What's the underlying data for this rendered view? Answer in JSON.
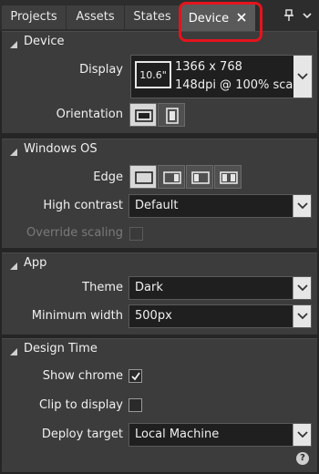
{
  "tabs": [
    {
      "label": "Projects"
    },
    {
      "label": "Assets"
    },
    {
      "label": "States"
    },
    {
      "label": "Device"
    }
  ],
  "sections": {
    "device": {
      "title": "Device",
      "display_label": "Display",
      "display_size": "10.6\"",
      "display_resolution": "1366 x 768",
      "display_dpi": "148dpi @ 100% scale",
      "orientation_label": "Orientation"
    },
    "windows": {
      "title": "Windows OS",
      "edge_label": "Edge",
      "high_contrast_label": "High contrast",
      "high_contrast_value": "Default",
      "override_scaling_label": "Override scaling"
    },
    "app": {
      "title": "App",
      "theme_label": "Theme",
      "theme_value": "Dark",
      "min_width_label": "Minimum width",
      "min_width_value": "500px"
    },
    "design": {
      "title": "Design Time",
      "show_chrome_label": "Show chrome",
      "show_chrome_checked": true,
      "clip_label": "Clip to display",
      "clip_checked": false,
      "deploy_label": "Deploy target",
      "deploy_value": "Local Machine"
    }
  },
  "icons": {
    "pin": "pin-icon",
    "help": "help-icon"
  },
  "colors": {
    "highlight": "#e3141d",
    "background": "#3c3c3c"
  }
}
